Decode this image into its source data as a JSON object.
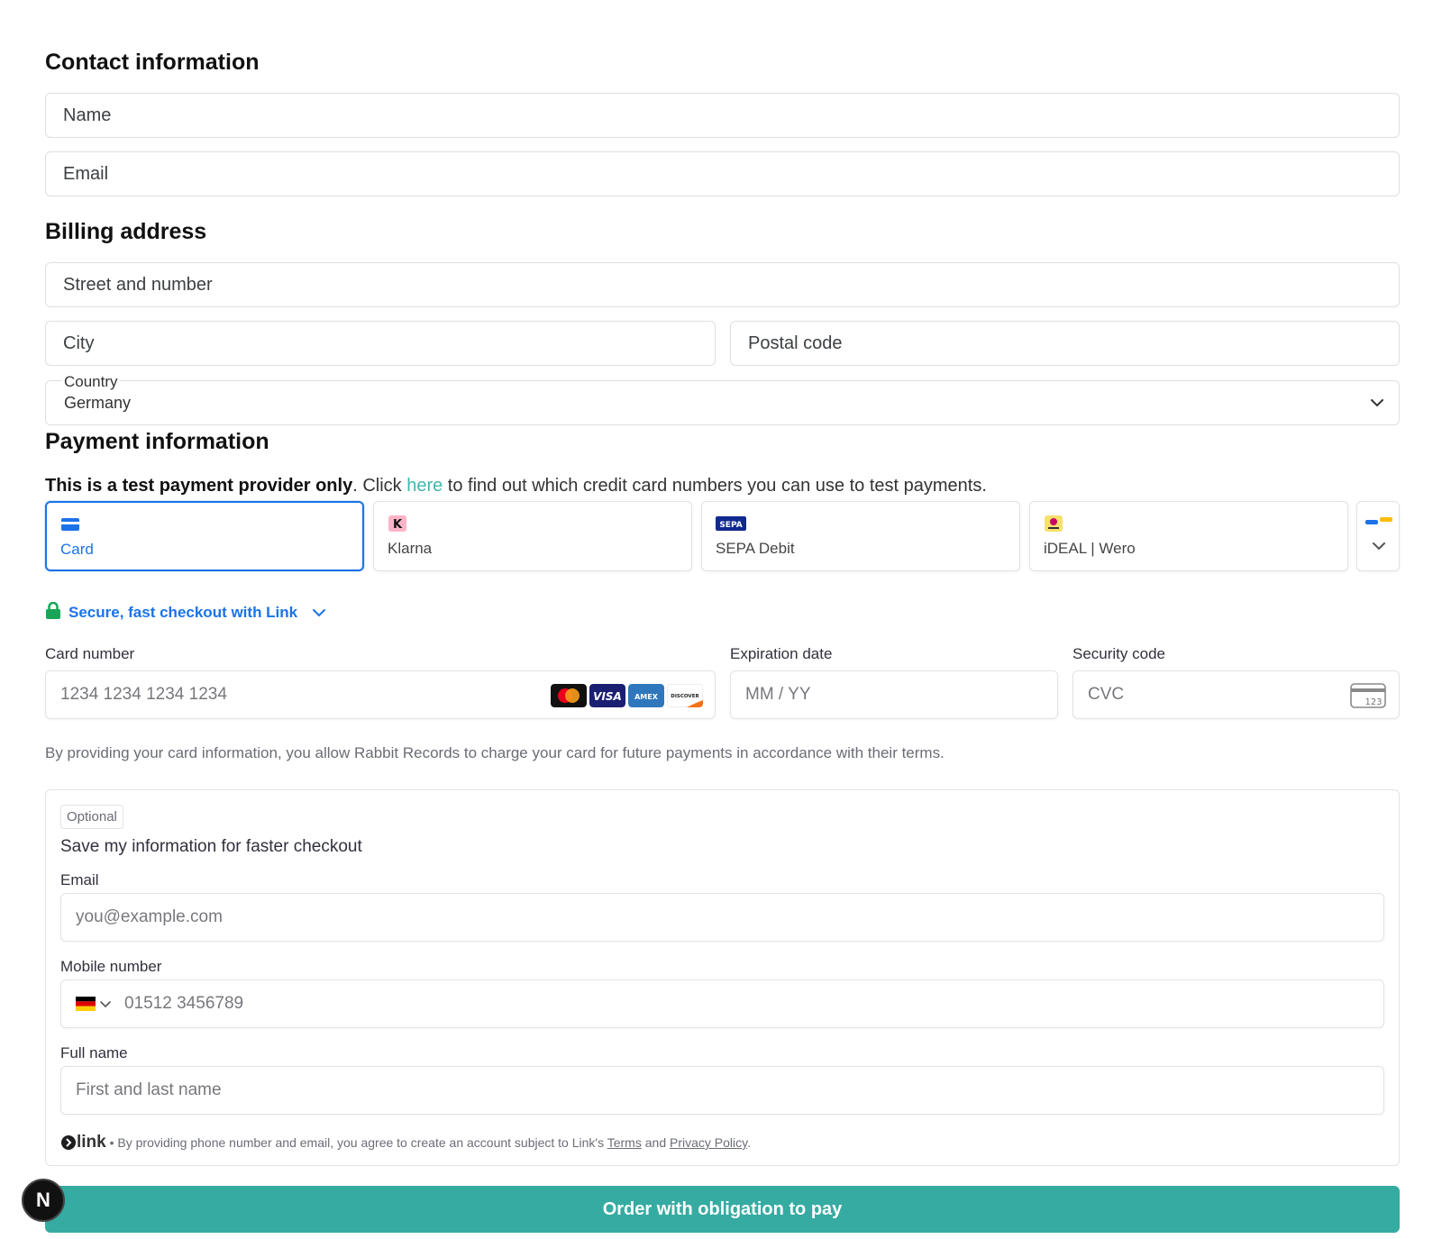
{
  "contact": {
    "heading": "Contact information",
    "name_placeholder": "Name",
    "email_placeholder": "Email"
  },
  "billing": {
    "heading": "Billing address",
    "street_placeholder": "Street and number",
    "city_placeholder": "City",
    "postal_placeholder": "Postal code",
    "country_label": "Country",
    "country_value": "Germany"
  },
  "payment": {
    "heading": "Payment information",
    "note_bold": "This is a test payment provider only",
    "note_pre": ". Click ",
    "note_link": "here",
    "note_post": " to find out which credit card numbers you can use to test payments.",
    "methods": [
      {
        "label": "Card",
        "icon": "card-icon",
        "active": true
      },
      {
        "label": "Klarna",
        "icon": "klarna-icon",
        "active": false
      },
      {
        "label": "SEPA Debit",
        "icon": "sepa-icon",
        "active": false
      },
      {
        "label": "iDEAL | Wero",
        "icon": "ideal-icon",
        "active": false
      }
    ],
    "link_checkout": "Secure, fast checkout with Link",
    "card_number_label": "Card number",
    "card_number_placeholder": "1234 1234 1234 1234",
    "expiry_label": "Expiration date",
    "expiry_placeholder": "MM / YY",
    "cvc_label": "Security code",
    "cvc_placeholder": "CVC",
    "cvc_icon_text": "123",
    "brands": [
      {
        "name": "mastercard-icon",
        "text": ""
      },
      {
        "name": "visa-icon",
        "text": "VISA"
      },
      {
        "name": "amex-icon",
        "text": "AMEX"
      },
      {
        "name": "discover-icon",
        "text": "DISCOVER"
      }
    ],
    "authorization_text": "By providing your card information, you allow Rabbit Records to charge your card for future payments in accordance with their terms."
  },
  "link_save": {
    "badge": "Optional",
    "title": "Save my information for faster checkout",
    "email_label": "Email",
    "email_placeholder": "you@example.com",
    "mobile_label": "Mobile number",
    "mobile_placeholder": "01512 3456789",
    "fullname_label": "Full name",
    "fullname_placeholder": "First and last name",
    "link_brand": "link",
    "footer_pre": " • By providing phone number and email, you agree to create an account subject to Link's ",
    "footer_terms": "Terms",
    "footer_and": " and ",
    "footer_privacy": "Privacy Policy",
    "footer_end": "."
  },
  "order_button": "Order with obligation to pay",
  "corner_badge": "N",
  "colors": {
    "accent_blue": "#1a73e8",
    "teal": "#36aba2",
    "link_teal": "#3fb8ae"
  }
}
